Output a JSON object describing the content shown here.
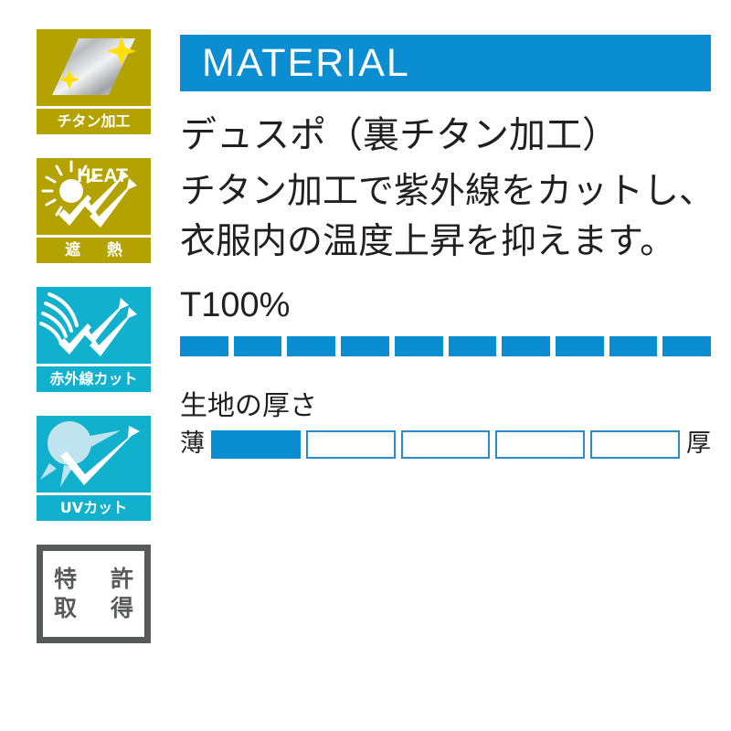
{
  "colors": {
    "brand_blue": "#0b8ed1",
    "gold": "#b3a200",
    "cyan": "#11b1ce",
    "gray": "#58595b",
    "text": "#231f20"
  },
  "badges": [
    {
      "id": "titanium-coating",
      "caption": "チタン加工",
      "theme": "gold",
      "art": "titanium-sheet-sparkle-icon"
    },
    {
      "id": "heat-shield",
      "caption": "遮　熱",
      "theme": "gold",
      "art": "sun-heat-arrows-icon",
      "art_text": "HEAT"
    },
    {
      "id": "infrared-cut",
      "caption": "赤外線カット",
      "theme": "cyan",
      "art": "infrared-waves-arrows-icon"
    },
    {
      "id": "uv-cut",
      "caption": "UVカット",
      "theme": "cyan",
      "art": "uv-sun-arrow-icon"
    }
  ],
  "patent": {
    "line1": "特　許",
    "line2": "取　得"
  },
  "header": {
    "title": "MATERIAL"
  },
  "product": {
    "name": "デュスポ（裏チタン加工）",
    "description": "チタン加工で紫外線をカットし、衣服内の温度上昇を抑えます。"
  },
  "transmittance": {
    "label": "T100%",
    "segments_total": 10,
    "segments_filled": 10
  },
  "thickness": {
    "title": "生地の厚さ",
    "min_label": "薄",
    "max_label": "厚",
    "cells_total": 5,
    "cells_filled": 1
  }
}
